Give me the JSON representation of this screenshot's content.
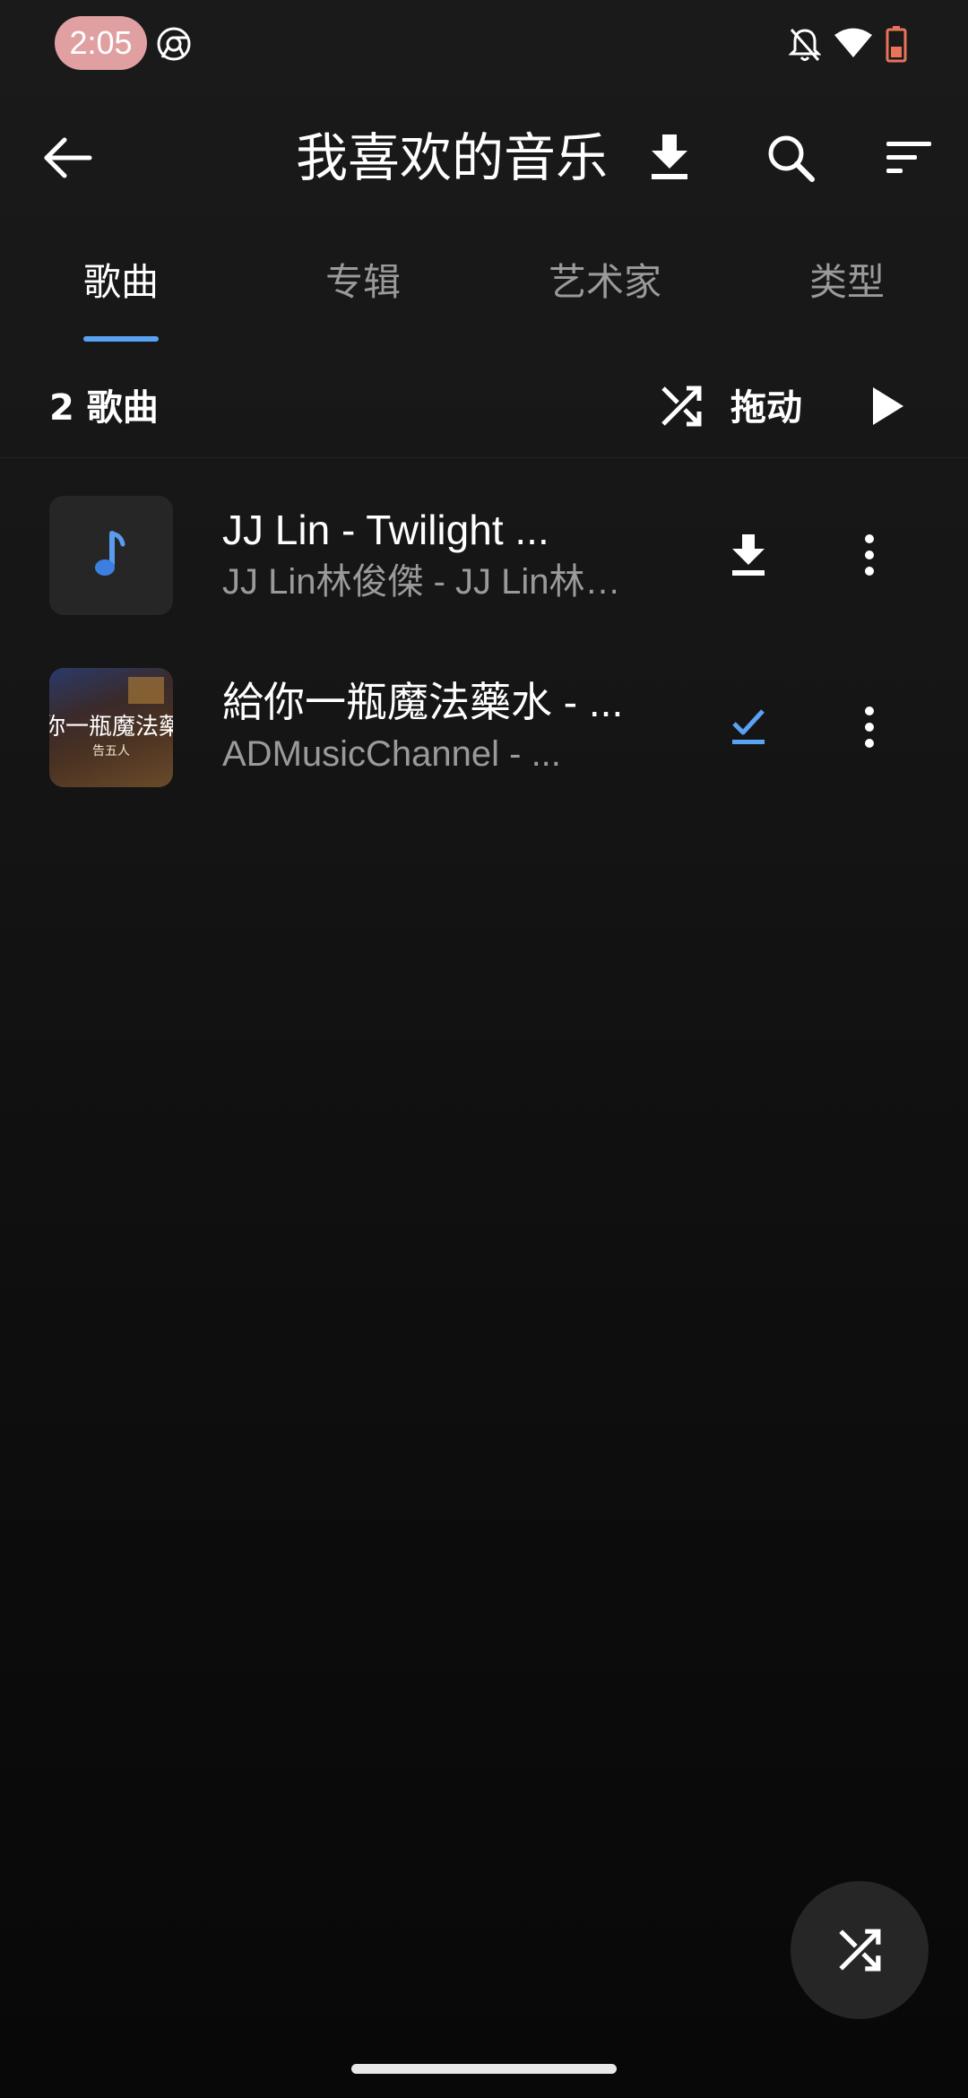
{
  "status_bar": {
    "time": "2:05",
    "icons": [
      "chrome-icon",
      "notifications-off-icon",
      "wifi-icon",
      "battery-icon"
    ]
  },
  "app_bar": {
    "title": "我喜欢的音乐",
    "icons": [
      "back-arrow-icon",
      "download-icon",
      "search-icon",
      "sort-icon"
    ]
  },
  "tabs": [
    {
      "label": "歌曲",
      "active": true
    },
    {
      "label": "专辑",
      "active": false
    },
    {
      "label": "艺术家",
      "active": false
    },
    {
      "label": "类型",
      "active": false
    }
  ],
  "toolbar": {
    "count_label": "2 歌曲",
    "shuffle_label": "拖动",
    "icons": [
      "shuffle-icon",
      "play-icon"
    ]
  },
  "songs": [
    {
      "title": "JJ Lin - Twilight ...",
      "subtitle": "JJ Lin林俊傑 - JJ Lin林…",
      "thumbnail": "music-note-icon",
      "status_icon": "download-icon",
      "menu_icon": "more-vert-icon"
    },
    {
      "title": "給你一瓶魔法藥水 - ...",
      "subtitle": "ADMusicChannel - ...",
      "thumbnail_text": "你一瓶魔法藥",
      "thumbnail_subtext": "告五人",
      "status_icon": "downloaded-check-icon",
      "menu_icon": "more-vert-icon"
    }
  ],
  "fab": {
    "icon": "shuffle-icon"
  },
  "colors": {
    "background": "#141414",
    "accent": "#5aa2f2",
    "text_primary": "#ffffff",
    "text_secondary": "#9a9a9a",
    "time_pill": "#e0a0a2",
    "battery": "#e8735a"
  }
}
